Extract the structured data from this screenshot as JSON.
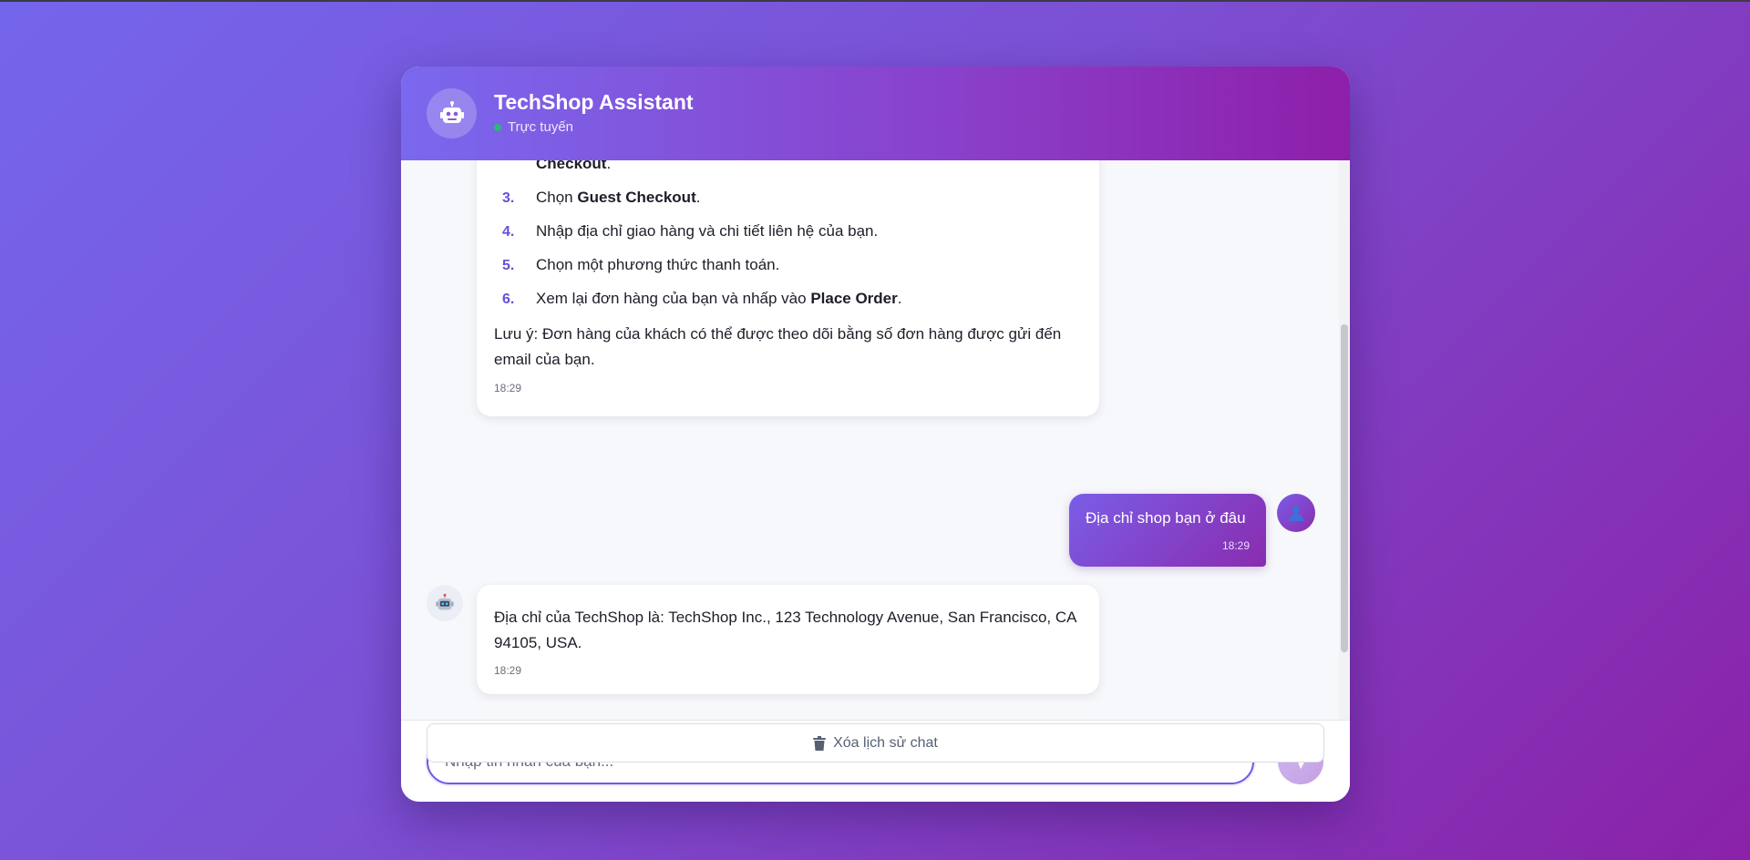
{
  "header": {
    "title": "TechShop Assistant",
    "status": "Trực tuyến",
    "avatar_icon": "robot-icon",
    "status_color": "#2ab877"
  },
  "messages": {
    "bot_1": {
      "partial_line": "Checkout",
      "partial_line_suffix": ".",
      "steps": [
        {
          "num": "3.",
          "prefix": "Chọn ",
          "bold": "Guest Checkout",
          "suffix": "."
        },
        {
          "num": "4.",
          "prefix": "Nhập địa chỉ giao hàng và chi tiết liên hệ của bạn.",
          "bold": "",
          "suffix": ""
        },
        {
          "num": "5.",
          "prefix": "Chọn một phương thức thanh toán.",
          "bold": "",
          "suffix": ""
        },
        {
          "num": "6.",
          "prefix": "Xem lại đơn hàng của bạn và nhấp vào ",
          "bold": "Place Order",
          "suffix": "."
        }
      ],
      "note": "Lưu ý: Đơn hàng của khách có thể được theo dõi bằng số đơn hàng được gửi đến email của bạn.",
      "time": "18:29"
    },
    "user_1": {
      "text": "Địa chỉ shop bạn ở đâu",
      "time": "18:29",
      "avatar_icon": "user-icon"
    },
    "bot_2": {
      "text": "Địa chỉ của TechShop là: TechShop Inc., 123 Technology Avenue, San Francisco, CA 94105, USA.",
      "time": "18:29",
      "avatar_icon": "robot-icon"
    }
  },
  "input": {
    "placeholder": "Nhập tin nhắn của bạn...",
    "value": "",
    "send_icon": "send-icon"
  },
  "footer": {
    "clear_label": "Xóa lịch sử chat",
    "clear_icon": "trash-icon"
  },
  "colors": {
    "accent": "#6c5ce7",
    "gradient_start": "#7466ec",
    "gradient_end": "#8a22a8"
  }
}
